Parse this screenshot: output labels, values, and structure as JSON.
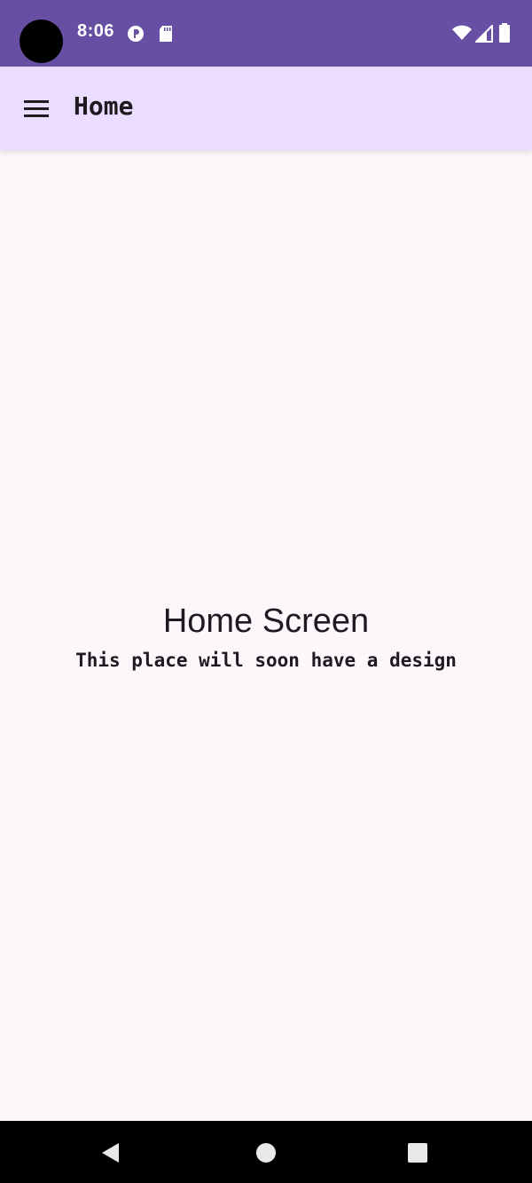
{
  "status_bar": {
    "time": "8:06",
    "background_color": "#6750a4",
    "left_icons": [
      "camera-cutout",
      "p-badge-icon",
      "sd-card-icon"
    ],
    "right_icons": [
      "wifi-icon",
      "cell-signal-icon",
      "battery-icon"
    ]
  },
  "app_bar": {
    "title": "Home",
    "background_color": "#eaddff",
    "menu_icon": "hamburger-menu-icon"
  },
  "main": {
    "title": "Home Screen",
    "subtitle": "This place will soon have a design",
    "background_color": "#fdf7fb"
  },
  "nav_bar": {
    "buttons": [
      "back-icon",
      "home-icon",
      "recent-apps-icon"
    ],
    "background_color": "#000000"
  }
}
